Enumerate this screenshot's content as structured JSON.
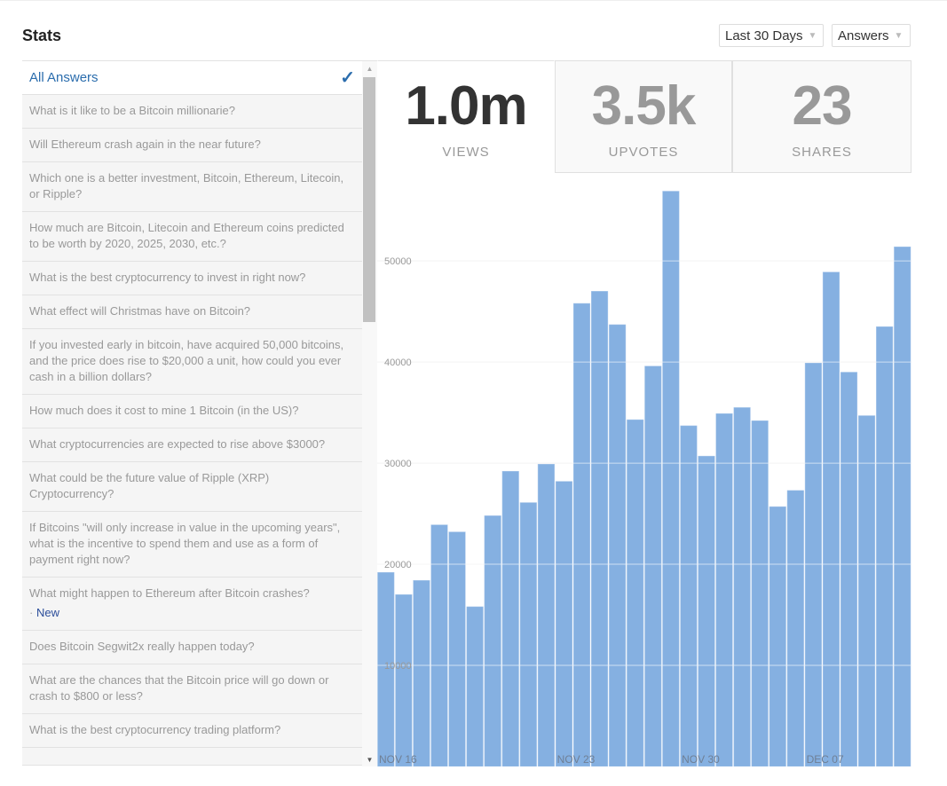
{
  "header": {
    "title": "Stats",
    "range_select": "Last 30 Days",
    "type_select": "Answers"
  },
  "list": {
    "all_label": "All Answers",
    "items": [
      {
        "text": "What is it like to be a Bitcoin millionarie?"
      },
      {
        "text": "Will Ethereum crash again in the near future?"
      },
      {
        "text": "Which one is a better investment, Bitcoin, Ethereum, Litecoin, or Ripple?"
      },
      {
        "text": "How much are Bitcoin, Litecoin and Ethereum coins predicted to be worth by 2020, 2025, 2030, etc.?"
      },
      {
        "text": "What is the best cryptocurrency to invest in right now?"
      },
      {
        "text": "What effect will Christmas have on Bitcoin?"
      },
      {
        "text": "If you invested early in bitcoin, have acquired 50,000 bitcoins, and the price does rise to $20,000 a unit, how could you ever cash in a billion dollars?"
      },
      {
        "text": "How much does it cost to mine 1 Bitcoin (in the US)?"
      },
      {
        "text": "What cryptocurrencies are expected to rise above $3000?"
      },
      {
        "text": "What could be the future value of Ripple (XRP) Cryptocurrency?"
      },
      {
        "text": "If Bitcoins \"will only increase in value in the upcoming years\", what is the incentive to spend them and use as a form of payment right now?"
      },
      {
        "text": "What might happen to Ethereum after Bitcoin crashes?",
        "badge": "New"
      },
      {
        "text": "Does Bitcoin Segwit2x really happen today?"
      },
      {
        "text": "What are the chances that the Bitcoin price will go down or crash to $800 or less?"
      },
      {
        "text": "What is the best cryptocurrency trading platform?"
      },
      {
        "text": ""
      }
    ]
  },
  "stats": [
    {
      "value": "1.0m",
      "label": "VIEWS",
      "active": true
    },
    {
      "value": "3.5k",
      "label": "UPVOTES",
      "active": false
    },
    {
      "value": "23",
      "label": "SHARES",
      "active": false
    }
  ],
  "colors": {
    "bar": "#85b0e1",
    "accent": "#2b6dad"
  },
  "chart_data": {
    "type": "bar",
    "values": [
      19200,
      17000,
      18400,
      23900,
      23200,
      15800,
      24800,
      29200,
      26100,
      29900,
      28200,
      45800,
      47000,
      43700,
      34300,
      39600,
      56900,
      33700,
      30700,
      34900,
      35500,
      34200,
      25700,
      27300,
      39900,
      48900,
      39000,
      34700,
      43500,
      51400
    ],
    "y_ticks": [
      0,
      10000,
      20000,
      30000,
      40000,
      50000
    ],
    "ylim": [
      0,
      58700
    ],
    "x_ticks": [
      {
        "index": 0,
        "label": "NOV 16"
      },
      {
        "index": 10,
        "label": "NOV 23"
      },
      {
        "index": 17,
        "label": "NOV 30"
      },
      {
        "index": 24,
        "label": "DEC 07"
      }
    ],
    "grid": true
  }
}
